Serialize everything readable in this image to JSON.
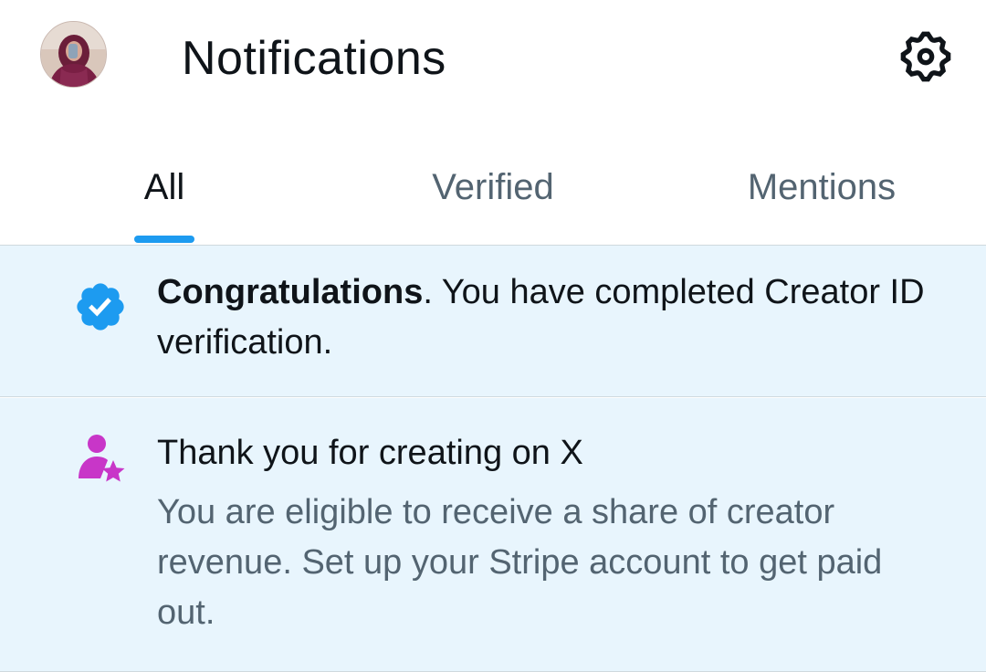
{
  "header": {
    "title": "Notifications",
    "avatar_icon": "user-avatar",
    "settings_icon": "gear-icon"
  },
  "tabs": [
    {
      "label": "All",
      "active": true
    },
    {
      "label": "Verified",
      "active": false
    },
    {
      "label": "Mentions",
      "active": false
    }
  ],
  "notifications": [
    {
      "icon": "verified-badge-icon",
      "icon_color": "#1d9bf0",
      "bold": "Congratulations",
      "text": ".  You have completed Creator ID verification."
    },
    {
      "icon": "creator-star-icon",
      "icon_color": "#c836c8",
      "title": "Thank you for creating on X",
      "subtitle": "You are eligible to receive a share of creator revenue. Set up your Stripe account to get paid out."
    }
  ],
  "colors": {
    "accent": "#1d9bf0",
    "unread_bg": "#e8f5fd",
    "secondary_text": "#536471",
    "border": "#cfd9de"
  }
}
